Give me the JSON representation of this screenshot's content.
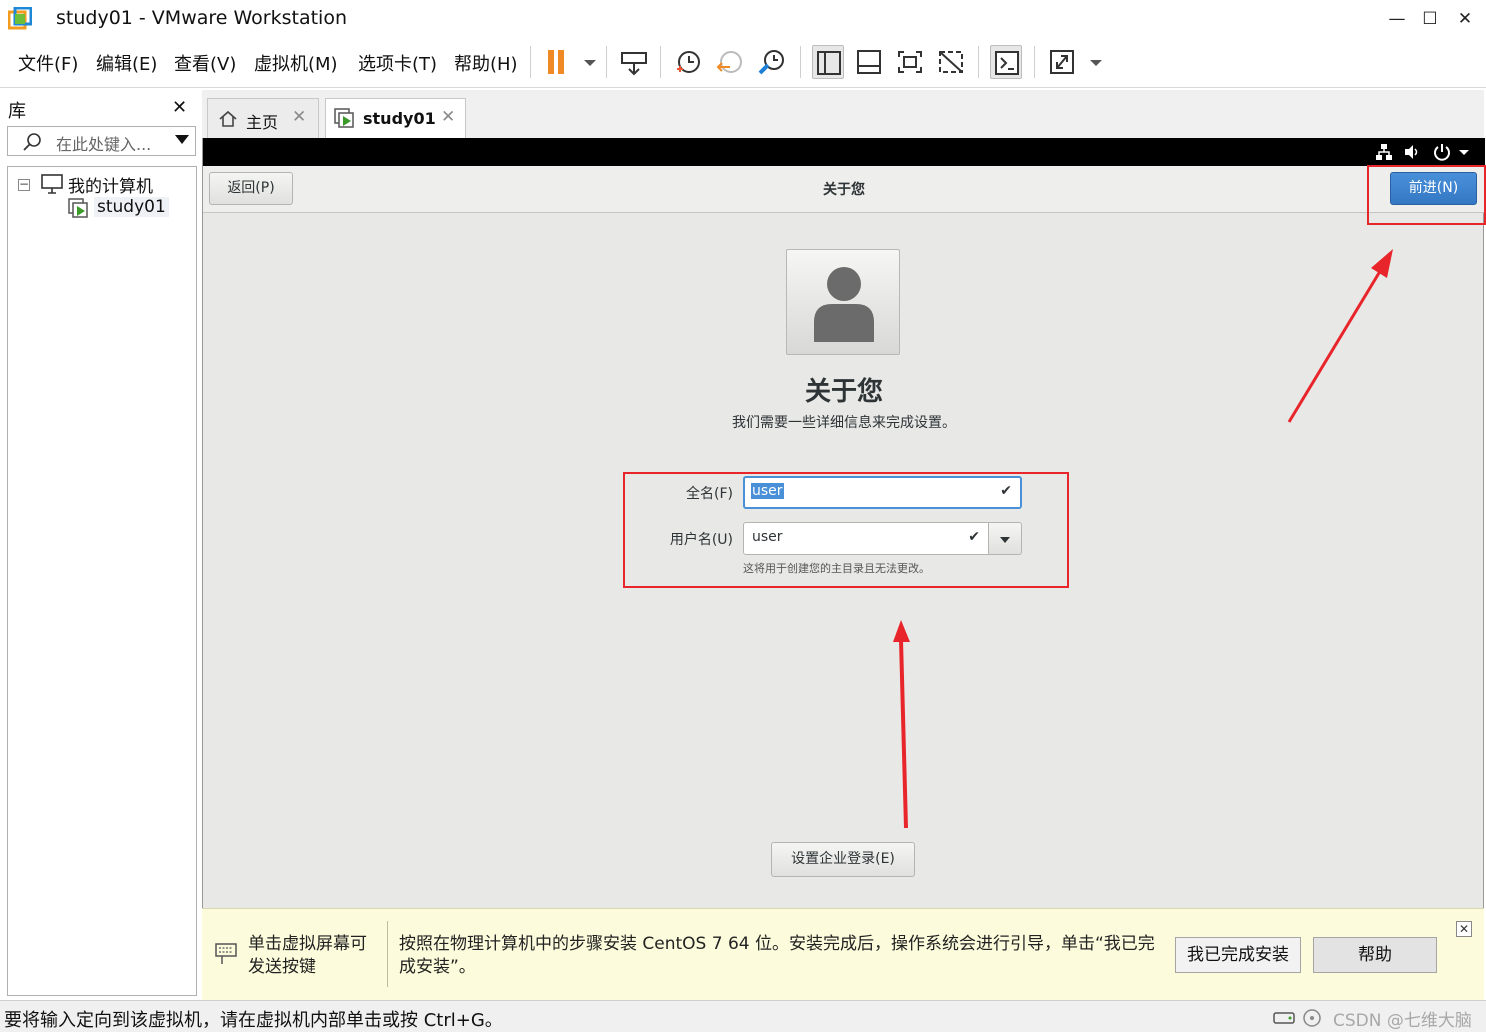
{
  "window": {
    "title": "study01 - VMware Workstation",
    "controls": {
      "minimize": "—",
      "maximize": "☐",
      "close": "✕"
    }
  },
  "menu": [
    "文件(F)",
    "编辑(E)",
    "查看(V)",
    "虚拟机(M)",
    "选项卡(T)",
    "帮助(H)"
  ],
  "toolbar": {
    "icons": [
      "pause-icon",
      "send-keys-icon",
      "snapshot-icon",
      "revert-snapshot-icon",
      "snapshot-manager-icon",
      "show-library-icon",
      "thumbnail-bar-icon",
      "full-screen-icon",
      "unity-icon",
      "console-icon",
      "stretch-icon"
    ],
    "pause_color": "#f08a24"
  },
  "library": {
    "title": "库",
    "close": "✕",
    "search_placeholder": "在此处键入...",
    "tree": {
      "root": "我的计算机",
      "child": "study01",
      "expander": "−"
    }
  },
  "tabs": [
    {
      "label": "主页",
      "close": "✕"
    },
    {
      "label": "study01",
      "close": "✕"
    }
  ],
  "installer": {
    "back": "返回(P)",
    "header_title": "关于您",
    "next": "前进(N)",
    "heading": "关于您",
    "subheading": "我们需要一些详细信息来完成设置。",
    "fullname_label": "全名(F)",
    "fullname_value": "user",
    "username_label": "用户名(U)",
    "username_value": "user",
    "check": "✔",
    "username_hint": "这将用于创建您的主目录且无法更改。",
    "enterprise": "设置企业登录(E)",
    "accent_color": "#4a90d9"
  },
  "hint_bar": {
    "left_text": "单击虚拟屏幕可发送按键",
    "main_text": "按照在物理计算机中的步骤安装 CentOS 7 64 位。安装完成后，操作系统会进行引导，单击“我已完成安装”。",
    "done_button": "我已完成安装",
    "help_button": "帮助",
    "close": "✕"
  },
  "status": {
    "text": "要将输入定向到该虚拟机，请在虚拟机内部单击或按 Ctrl+G。",
    "watermark": "CSDN @七维大脑"
  },
  "annotation_color": "#e8252a"
}
